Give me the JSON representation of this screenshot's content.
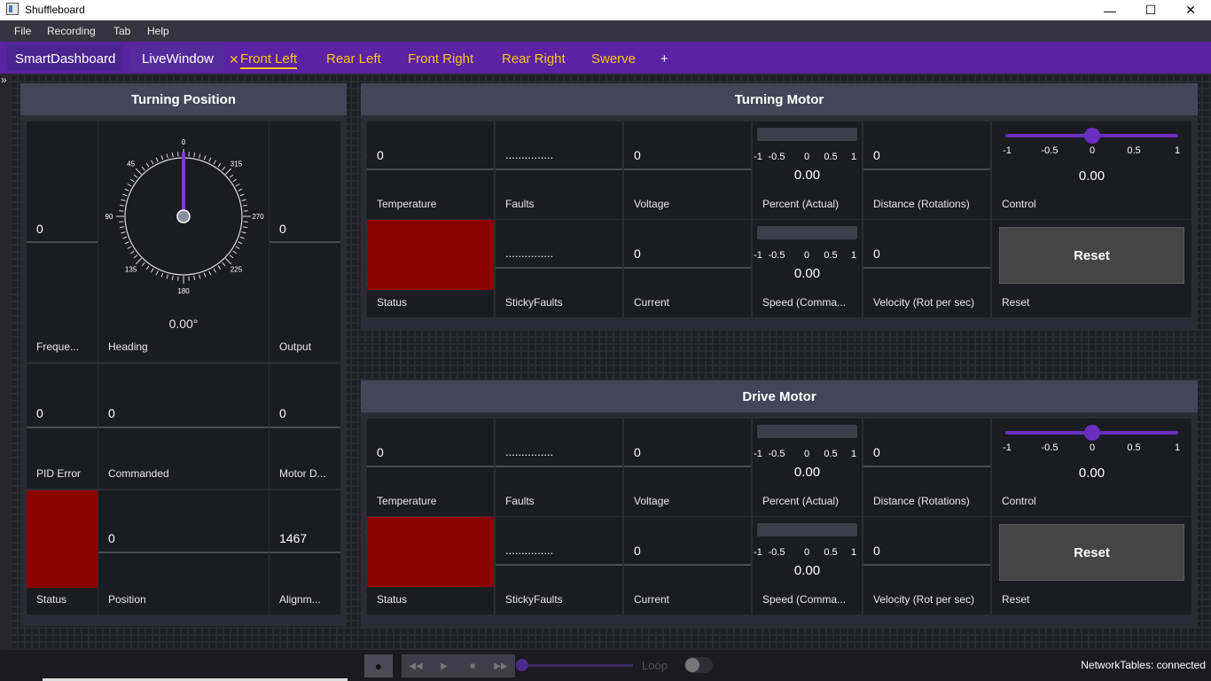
{
  "window": {
    "title": "Shuffleboard",
    "minimize": "—",
    "maximize": "☐",
    "close": "✕"
  },
  "menu": [
    "File",
    "Recording",
    "Tab",
    "Help"
  ],
  "tabs": {
    "smartdashboard": "SmartDashboard",
    "livewindow": "LiveWindow",
    "close_glyph": "✕",
    "front_left": "Front Left",
    "rear_left": "Rear Left",
    "front_right": "Front Right",
    "rear_right": "Rear Right",
    "swerve": "Swerve",
    "add": "+"
  },
  "sidebar_toggle": "»",
  "turning_position": {
    "title": "Turning Position",
    "frequency": {
      "value": "0",
      "label": "Freque..."
    },
    "heading": {
      "label": "Heading",
      "value": "0.00°",
      "ticks": [
        "0",
        "45",
        "90",
        "135",
        "180",
        "225",
        "270",
        "315"
      ],
      "angle_deg": 0
    },
    "output": {
      "value": "0",
      "label": "Output"
    },
    "pid_error": {
      "value": "0",
      "label": "PID Error"
    },
    "commanded": {
      "value": "0",
      "label": "Commanded"
    },
    "motor_d": {
      "value": "0",
      "label": "Motor D..."
    },
    "status": {
      "label": "Status",
      "color": "#8b0000"
    },
    "position": {
      "value": "0",
      "label": "Position"
    },
    "alignment": {
      "value": "1467",
      "label": "Alignm..."
    }
  },
  "turning_motor": {
    "title": "Turning Motor",
    "temperature": {
      "value": "0",
      "label": "Temperature"
    },
    "faults": {
      "value": "...............",
      "label": "Faults"
    },
    "voltage": {
      "value": "0",
      "label": "Voltage"
    },
    "percent": {
      "label": "Percent (Actual)",
      "value": "0.00",
      "scale": [
        "-1",
        "-0.5",
        "0",
        "0.5",
        "1"
      ]
    },
    "distance": {
      "value": "0",
      "label": "Distance (Rotations)"
    },
    "control": {
      "label": "Control",
      "value": "0.00",
      "scale": [
        "-1",
        "-0.5",
        "0",
        "0.5",
        "1"
      ],
      "slider_value": 0
    },
    "status": {
      "label": "Status",
      "color": "#8b0000"
    },
    "sticky": {
      "value": "...............",
      "label": "StickyFaults"
    },
    "current": {
      "value": "0",
      "label": "Current"
    },
    "speed": {
      "label": "Speed (Comma...",
      "value": "0.00",
      "scale": [
        "-1",
        "-0.5",
        "0",
        "0.5",
        "1"
      ]
    },
    "velocity": {
      "value": "0",
      "label": "Velocity (Rot per sec)"
    },
    "reset": {
      "button": "Reset",
      "label": "Reset"
    }
  },
  "drive_motor": {
    "title": "Drive Motor",
    "temperature": {
      "value": "0",
      "label": "Temperature"
    },
    "faults": {
      "value": "...............",
      "label": "Faults"
    },
    "voltage": {
      "value": "0",
      "label": "Voltage"
    },
    "percent": {
      "label": "Percent (Actual)",
      "value": "0.00",
      "scale": [
        "-1",
        "-0.5",
        "0",
        "0.5",
        "1"
      ]
    },
    "distance": {
      "value": "0",
      "label": "Distance (Rotations)"
    },
    "control": {
      "label": "Control",
      "value": "0.00",
      "scale": [
        "-1",
        "-0.5",
        "0",
        "0.5",
        "1"
      ],
      "slider_value": 0
    },
    "status": {
      "label": "Status",
      "color": "#8b0000"
    },
    "sticky": {
      "value": "...............",
      "label": "StickyFaults"
    },
    "current": {
      "value": "0",
      "label": "Current"
    },
    "speed": {
      "label": "Speed (Comma...",
      "value": "0.00",
      "scale": [
        "-1",
        "-0.5",
        "0",
        "0.5",
        "1"
      ]
    },
    "velocity": {
      "value": "0",
      "label": "Velocity (Rot per sec)"
    },
    "reset": {
      "button": "Reset",
      "label": "Reset"
    }
  },
  "playback": {
    "loop_label": "Loop",
    "record_icon": "record-icon",
    "rewind_icon": "rewind-icon",
    "play_icon": "play-icon",
    "stop_icon": "stop-icon",
    "fast_forward_icon": "fast-forward-icon"
  },
  "status": {
    "text": "NetworkTables: connected"
  },
  "colors": {
    "accent": "#5b22a3",
    "tab_text": "#f5c518",
    "status_red": "#8b0000",
    "slider": "#6a2fbf"
  }
}
